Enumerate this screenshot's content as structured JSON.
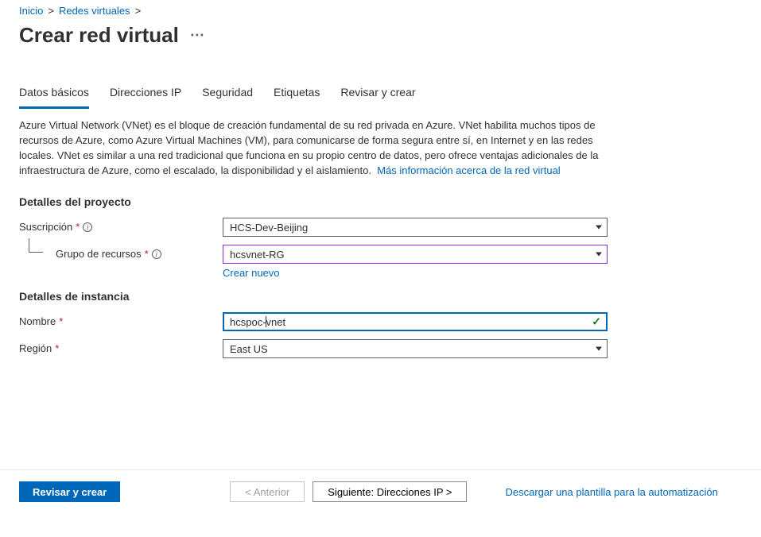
{
  "breadcrumb": {
    "home": "Inicio",
    "vnets": "Redes virtuales"
  },
  "page_title": "Crear red virtual",
  "tabs": {
    "basics": "Datos básicos",
    "ip": "Direcciones IP",
    "security": "Seguridad",
    "tags": "Etiquetas",
    "review": "Revisar y crear"
  },
  "description_text": "Azure Virtual Network (VNet) es el bloque de creación fundamental de su red privada en Azure. VNet habilita muchos tipos de recursos de Azure, como Azure Virtual Machines (VM), para comunicarse de forma segura entre sí, en Internet y en las redes locales. VNet es similar a una red tradicional que funciona en su propio centro de datos, pero ofrece ventajas adicionales de la infraestructura de Azure, como el escalado, la disponibilidad y el aislamiento.",
  "description_link": "Más información acerca de la red virtual",
  "sections": {
    "project": "Detalles del proyecto",
    "instance": "Detalles de instancia"
  },
  "fields": {
    "subscription_label": "Suscripción",
    "subscription_value": "HCS-Dev-Beijing",
    "resource_group_label": "Grupo de recursos",
    "resource_group_value": "hcsvnet-RG",
    "create_new": "Crear nuevo",
    "name_label": "Nombre",
    "name_value_pre": "hcspoc",
    "name_value_post": "vnet",
    "region_label": "Región",
    "region_value": "East US"
  },
  "footer": {
    "review": "Revisar y crear",
    "prev": "< Anterior",
    "next": "Siguiente: Direcciones IP >",
    "template_link": "Descargar una plantilla para la automatización"
  }
}
